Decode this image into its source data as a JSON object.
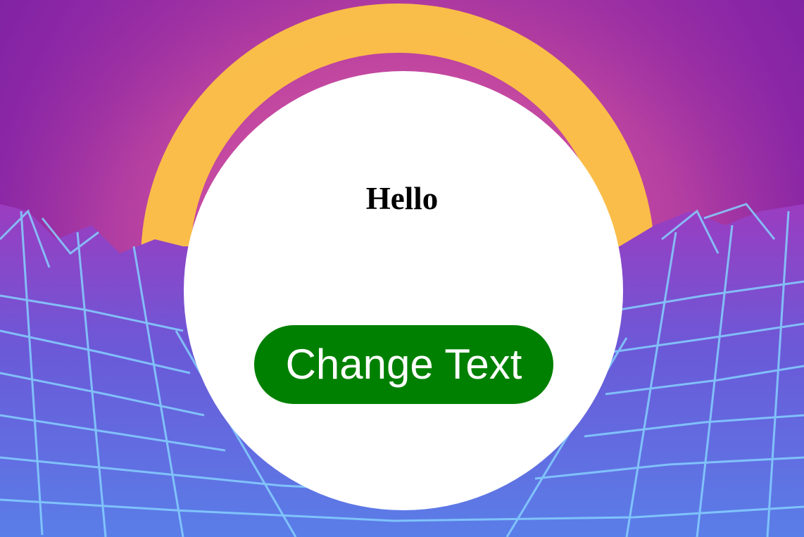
{
  "page": {
    "heading": "Hello",
    "button_label": "Change Text"
  },
  "colors": {
    "button_background": "#008000",
    "button_text": "#ffffff",
    "card_background": "#ffffff",
    "sun": "#fdc445",
    "sky": "#a42ea2",
    "grid_lines": "#7ec8ff"
  },
  "background": {
    "description_icon": "synthwave-sun-grid-background"
  }
}
